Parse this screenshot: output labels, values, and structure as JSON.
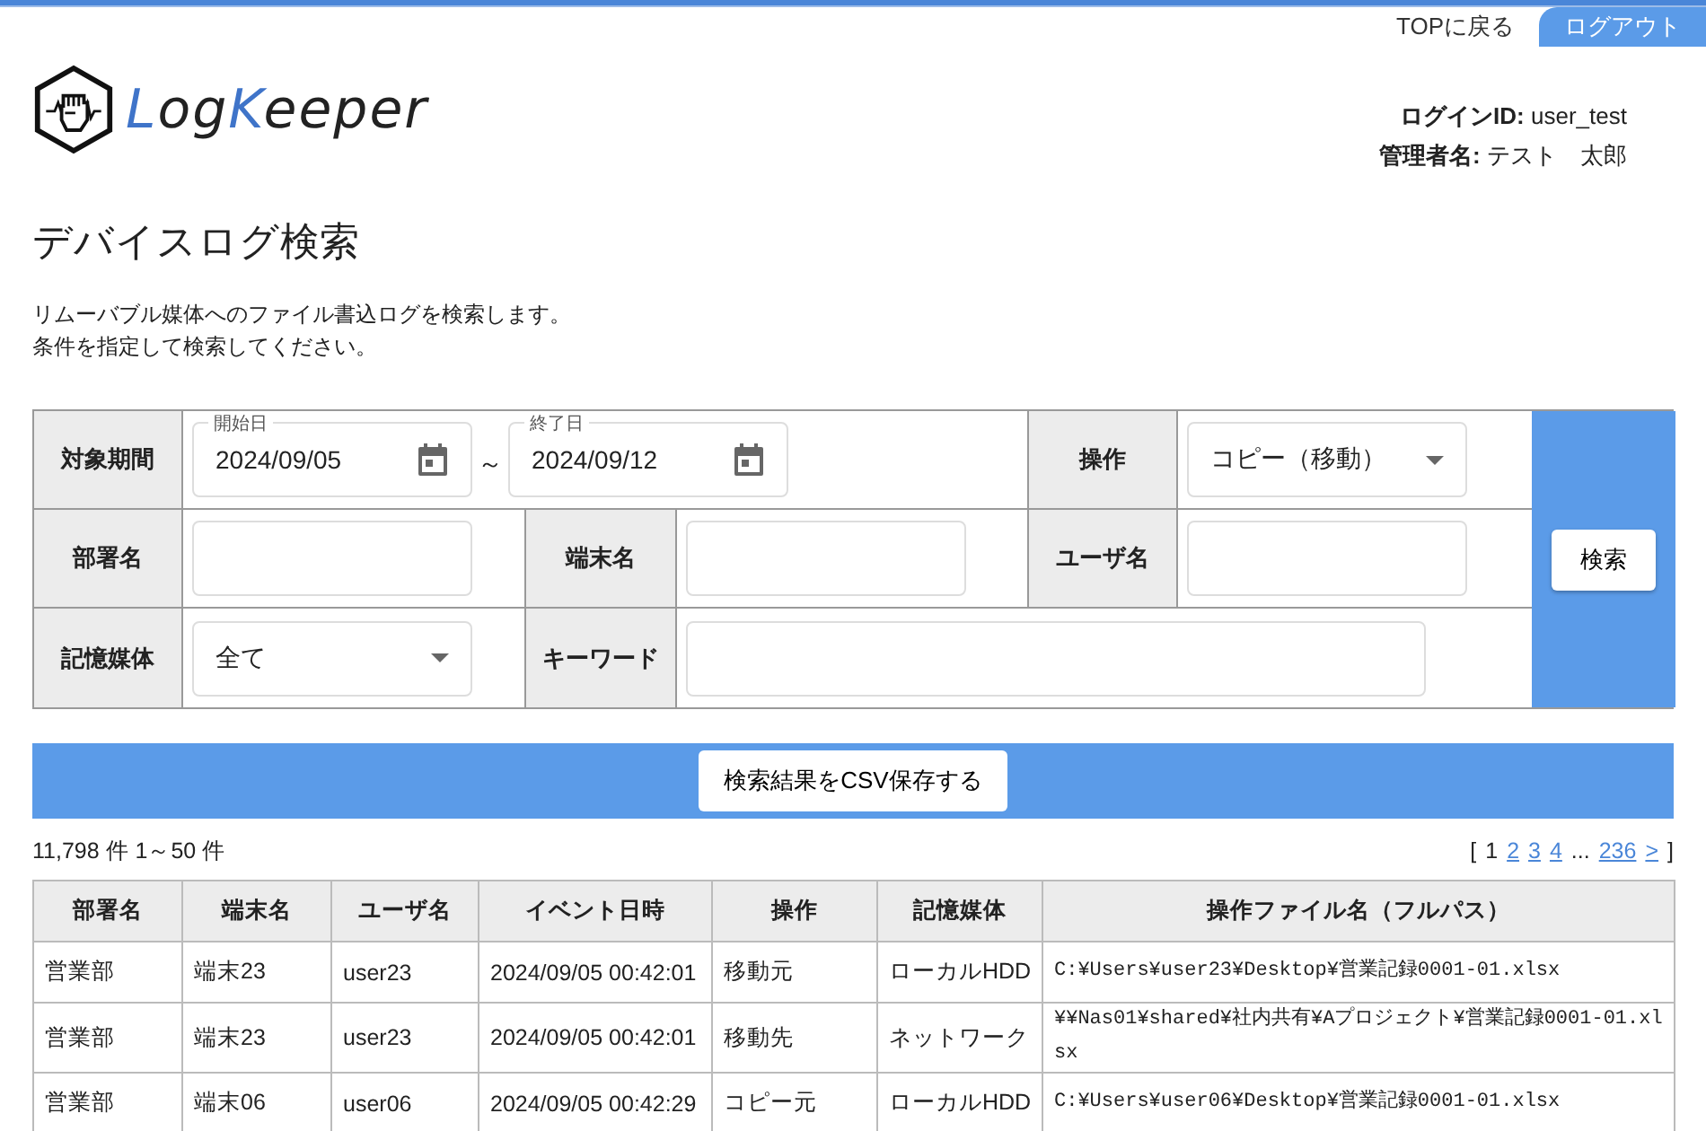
{
  "header": {
    "top_link": "TOPに戻る",
    "logout": "ログアウト",
    "logo_parts": [
      {
        "text": "L",
        "accent": true
      },
      {
        "text": "og",
        "accent": false
      },
      {
        "text": "K",
        "accent": true
      },
      {
        "text": "eeper",
        "accent": false
      }
    ],
    "user_info": [
      {
        "label": "ログインID:",
        "value": "user_test"
      },
      {
        "label": "管理者名:",
        "value": "テスト　太郎"
      }
    ]
  },
  "page": {
    "title": "デバイスログ検索",
    "description": [
      "リムーバブル媒体へのファイル書込ログを検索します。",
      "条件を指定して検索してください。"
    ]
  },
  "form": {
    "period": {
      "label": "対象期間",
      "start": {
        "label": "開始日",
        "value": "2024/09/05"
      },
      "separator": "～",
      "end": {
        "label": "終了日",
        "value": "2024/09/12"
      }
    },
    "operation": {
      "label": "操作",
      "value": "コピー（移動）"
    },
    "department": {
      "label": "部署名"
    },
    "terminal": {
      "label": "端末名"
    },
    "user": {
      "label": "ユーザ名"
    },
    "media": {
      "label": "記憶媒体",
      "value": "全て"
    },
    "keyword": {
      "label": "キーワード"
    },
    "search_button": "検索"
  },
  "csv_button": "検索結果をCSV保存する",
  "summary": "11,798 件 1～50 件",
  "pagination": [
    {
      "kind": "bracket",
      "label": "["
    },
    {
      "kind": "page",
      "label": "1",
      "selected": true
    },
    {
      "kind": "page",
      "label": "2",
      "selected": false
    },
    {
      "kind": "page",
      "label": "3",
      "selected": false
    },
    {
      "kind": "page",
      "label": "4",
      "selected": false
    },
    {
      "kind": "ellipsis",
      "label": "..."
    },
    {
      "kind": "page",
      "label": "236",
      "selected": false
    },
    {
      "kind": "page",
      "label": ">",
      "selected": false
    },
    {
      "kind": "bracket",
      "label": "]"
    }
  ],
  "table": {
    "columns": [
      "部署名",
      "端末名",
      "ユーザ名",
      "イベント日時",
      "操作",
      "記憶媒体",
      "操作ファイル名（フルパス）"
    ],
    "rows": [
      [
        "営業部",
        "端末23",
        "user23",
        "2024/09/05 00:42:01",
        "移動元",
        "ローカルHDD",
        "C:¥Users¥user23¥Desktop¥営業記録0001-01.xlsx"
      ],
      [
        "営業部",
        "端末23",
        "user23",
        "2024/09/05 00:42:01",
        "移動先",
        "ネットワーク",
        "¥¥Nas01¥shared¥社内共有¥Aプロジェクト¥営業記録0001-01.xlsx"
      ],
      [
        "営業部",
        "端末06",
        "user06",
        "2024/09/05 00:42:29",
        "コピー元",
        "ローカルHDD",
        "C:¥Users¥user06¥Desktop¥営業記録0001-01.xlsx"
      ]
    ]
  }
}
